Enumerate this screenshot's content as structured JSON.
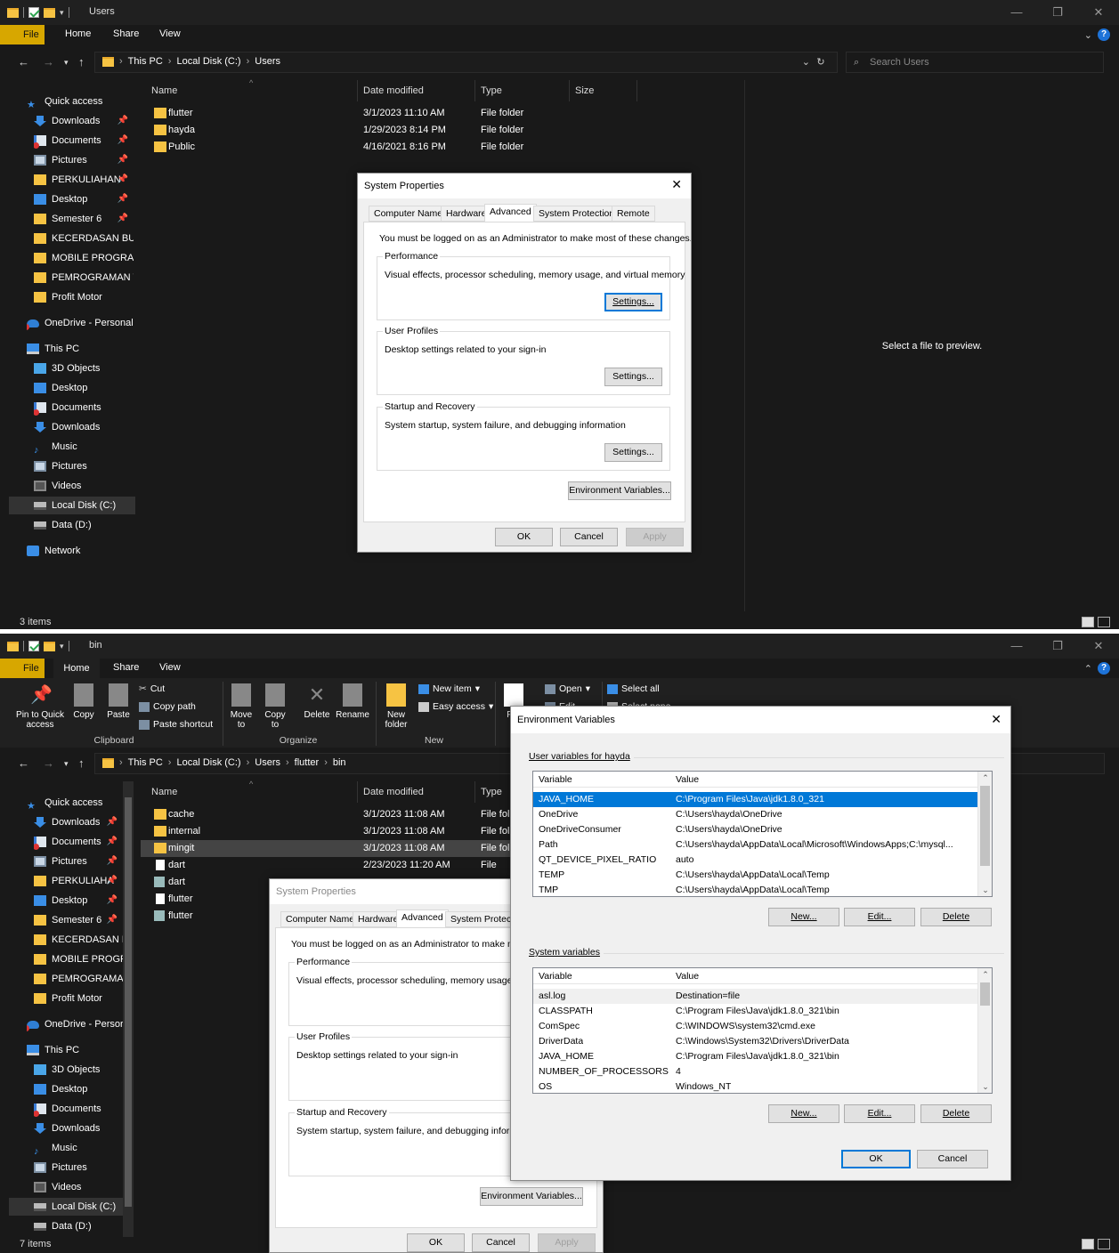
{
  "top": {
    "title": "Users",
    "ribbon_tabs": [
      "File",
      "Home",
      "Share",
      "View"
    ],
    "breadcrumb": [
      "This PC",
      "Local Disk (C:)",
      "Users"
    ],
    "search_placeholder": "Search Users",
    "columns": [
      "Name",
      "Date modified",
      "Type",
      "Size"
    ],
    "files": [
      {
        "name": "flutter",
        "date": "3/1/2023 11:10 AM",
        "type": "File folder"
      },
      {
        "name": "hayda",
        "date": "1/29/2023 8:14 PM",
        "type": "File folder"
      },
      {
        "name": "Public",
        "date": "4/16/2021 8:16 PM",
        "type": "File folder"
      }
    ],
    "sidebar": {
      "quick_access": "Quick access",
      "quick": [
        "Downloads",
        "Documents",
        "Pictures",
        "PERKULIAHAN",
        "Desktop",
        "Semester 6",
        "KECERDASAN BUAT",
        "MOBILE PROGRAM",
        "PEMROGRAMAN W",
        "Profit Motor"
      ],
      "onedrive": "OneDrive - Personal",
      "this_pc": "This PC",
      "pc": [
        "3D Objects",
        "Desktop",
        "Documents",
        "Downloads",
        "Music",
        "Pictures",
        "Videos",
        "Local Disk (C:)",
        "Data (D:)"
      ],
      "network": "Network"
    },
    "preview": "Select a file to preview.",
    "status": "3 items"
  },
  "sysprops": {
    "title": "System Properties",
    "tabs": [
      "Computer Name",
      "Hardware",
      "Advanced",
      "System Protection",
      "Remote"
    ],
    "admin_note": "You must be logged on as an Administrator to make most of these changes.",
    "perf_label": "Performance",
    "perf_desc": "Visual effects, processor scheduling, memory usage, and virtual memory",
    "profiles_label": "User Profiles",
    "profiles_desc": "Desktop settings related to your sign-in",
    "startup_label": "Startup and Recovery",
    "startup_desc": "System startup, system failure, and debugging information",
    "settings": "Settings...",
    "env_button": "Environment Variables...",
    "ok": "OK",
    "cancel": "Cancel",
    "apply": "Apply"
  },
  "bottom": {
    "title": "bin",
    "ribbon_tabs": [
      "File",
      "Home",
      "Share",
      "View"
    ],
    "ribbon": {
      "pin": "Pin to Quick access",
      "copy": "Copy",
      "paste": "Paste",
      "cut": "Cut",
      "copy_path": "Copy path",
      "paste_shortcut": "Paste shortcut",
      "move_to": "Move to",
      "copy_to": "Copy to",
      "delete": "Delete",
      "rename": "Rename",
      "new_folder": "New folder",
      "new_item": "New item",
      "easy_access": "Easy access",
      "properties": "Pro",
      "open": "Open",
      "edit": "Edit",
      "select_all": "Select all",
      "select_none": "Select none",
      "groups": [
        "Clipboard",
        "Organize",
        "New"
      ]
    },
    "breadcrumb": [
      "This PC",
      "Local Disk (C:)",
      "Users",
      "flutter",
      "bin"
    ],
    "columns": [
      "Name",
      "Date modified",
      "Type"
    ],
    "files": [
      {
        "name": "cache",
        "date": "3/1/2023 11:08 AM",
        "type": "File fol"
      },
      {
        "name": "internal",
        "date": "3/1/2023 11:08 AM",
        "type": "File fol"
      },
      {
        "name": "mingit",
        "date": "3/1/2023 11:08 AM",
        "type": "File fol"
      },
      {
        "name": "dart",
        "date": "2/23/2023 11:20 AM",
        "type": "File"
      },
      {
        "name": "dart",
        "date": "",
        "type": ""
      },
      {
        "name": "flutter",
        "date": "",
        "type": ""
      },
      {
        "name": "flutter",
        "date": "",
        "type": ""
      }
    ],
    "sidebar": {
      "quick_access": "Quick access",
      "quick": [
        "Downloads",
        "Documents",
        "Pictures",
        "PERKULIAHA",
        "Desktop",
        "Semester 6",
        "KECERDASAN BI",
        "MOBILE PROGR/",
        "PEMROGRAMAI",
        "Profit Motor"
      ],
      "onedrive": "OneDrive - Persor",
      "this_pc": "This PC",
      "pc": [
        "3D Objects",
        "Desktop",
        "Documents",
        "Downloads",
        "Music",
        "Pictures",
        "Videos",
        "Local Disk (C:)",
        "Data (D:)"
      ]
    },
    "status": "7 items"
  },
  "sysprops2": {
    "title": "System Properties",
    "tabs": [
      "Computer Name",
      "Hardware",
      "Advanced",
      "System Protectic"
    ],
    "admin_note": "You must be logged on as an Administrator to make most c",
    "perf_label": "Performance",
    "perf_desc": "Visual effects, processor scheduling, memory usage, and",
    "profiles_label": "User Profiles",
    "profiles_desc": "Desktop settings related to your sign-in",
    "startup_label": "Startup and Recovery",
    "startup_desc": "System startup, system failure, and debugging information",
    "env_button": "Environment Variables...",
    "ok": "OK",
    "cancel": "Cancel",
    "apply": "Apply"
  },
  "envvars": {
    "title": "Environment Variables",
    "user_label": "User variables for hayda",
    "col_variable": "Variable",
    "col_value": "Value",
    "user_vars": [
      {
        "var": "JAVA_HOME",
        "val": "C:\\Program Files\\Java\\jdk1.8.0_321"
      },
      {
        "var": "OneDrive",
        "val": "C:\\Users\\hayda\\OneDrive"
      },
      {
        "var": "OneDriveConsumer",
        "val": "C:\\Users\\hayda\\OneDrive"
      },
      {
        "var": "Path",
        "val": "C:\\Users\\hayda\\AppData\\Local\\Microsoft\\WindowsApps;C:\\mysql..."
      },
      {
        "var": "QT_DEVICE_PIXEL_RATIO",
        "val": "auto"
      },
      {
        "var": "TEMP",
        "val": "C:\\Users\\hayda\\AppData\\Local\\Temp"
      },
      {
        "var": "TMP",
        "val": "C:\\Users\\hayda\\AppData\\Local\\Temp"
      }
    ],
    "system_label": "System variables",
    "system_vars": [
      {
        "var": "asl.log",
        "val": "Destination=file"
      },
      {
        "var": "CLASSPATH",
        "val": "C:\\Program Files\\Java\\jdk1.8.0_321\\bin"
      },
      {
        "var": "ComSpec",
        "val": "C:\\WINDOWS\\system32\\cmd.exe"
      },
      {
        "var": "DriverData",
        "val": "C:\\Windows\\System32\\Drivers\\DriverData"
      },
      {
        "var": "JAVA_HOME",
        "val": "C:\\Program Files\\Java\\jdk1.8.0_321\\bin"
      },
      {
        "var": "NUMBER_OF_PROCESSORS",
        "val": "4"
      },
      {
        "var": "OS",
        "val": "Windows_NT"
      }
    ],
    "new": "New...",
    "edit": "Edit...",
    "delete": "Delete",
    "ok": "OK",
    "cancel": "Cancel"
  }
}
